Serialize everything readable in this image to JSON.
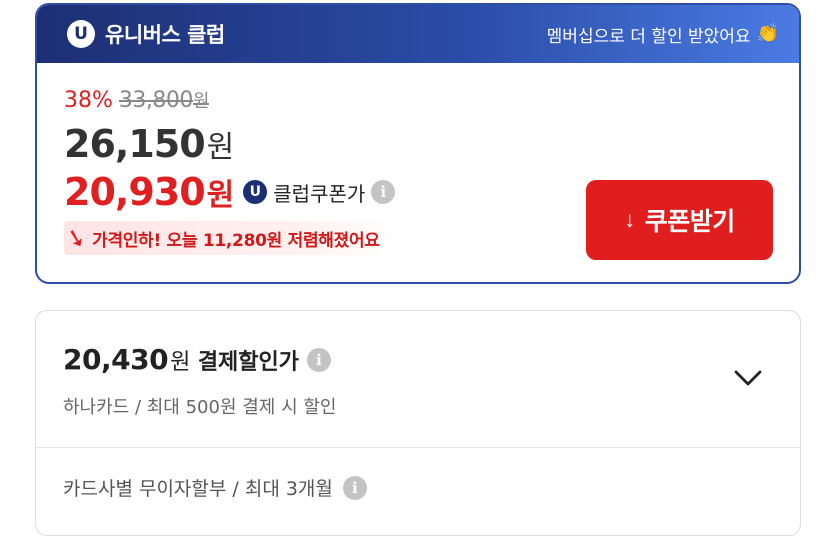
{
  "club": {
    "badge": "U",
    "title": "유니버스 클럽",
    "tagline": "멤버십으로 더 할인 받았어요",
    "discount_rate": "38%",
    "original_price": "33,800",
    "original_unit": "원",
    "sale_price": "26,150",
    "sale_unit": "원",
    "club_price": "20,930",
    "club_price_unit": "원",
    "club_price_label": "클럽쿠폰가",
    "price_drop_text": "가격인하! 오늘 11,280원 저렴해졌어요",
    "coupon_button": "쿠폰받기"
  },
  "payment": {
    "price": "20,430",
    "price_unit": "원",
    "label": "결제할인가",
    "sub": "하나카드 / 최대 500원 결제 시 할인",
    "installment": "카드사별 무이자할부 / 최대 3개월"
  },
  "icons": {
    "info": "i",
    "download": "↓",
    "arrow_down": "➘",
    "clap": "👏"
  },
  "colors": {
    "brand_navy": "#1d2f73",
    "accent_red": "#e01e1e",
    "header_gradient_end": "#4a7be3"
  }
}
